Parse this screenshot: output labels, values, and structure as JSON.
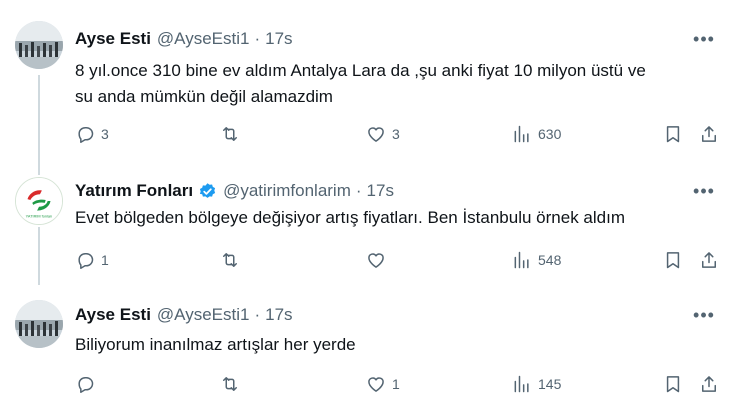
{
  "tweets": [
    {
      "name": "Ayse Esti",
      "handle": "@AyseEsti1",
      "dot": "·",
      "time": "17s",
      "text_lines": [
        "8 yıl.once 310 bine ev aldım  Antalya Lara da ,şu anki fiyat 10 milyon üstü ve",
        "su anda mümkün değil alamazdim"
      ],
      "replies": "3",
      "retweets": "",
      "likes": "3",
      "views": "630"
    },
    {
      "name": "Yatırım Fonları",
      "handle": "@yatirimfonlarim",
      "dot": "·",
      "time": "17s",
      "verified": true,
      "text_lines": [
        "Evet bölgeden bölgeye değişiyor artış fiyatları. Ben İstanbulu örnek aldım"
      ],
      "replies": "1",
      "retweets": "",
      "likes": "",
      "views": "548",
      "avatar_caption": "YATIRIM fonları"
    },
    {
      "name": "Ayse Esti",
      "handle": "@AyseEsti1",
      "dot": "·",
      "time": "17s",
      "text_lines": [
        "Biliyorum  inanılmaz artışlar her yerde"
      ],
      "replies": "",
      "retweets": "",
      "likes": "1",
      "views": "145"
    }
  ],
  "icons": {
    "more": "more-horizontal-icon",
    "reply": "reply-icon",
    "retweet": "retweet-icon",
    "like": "heart-icon",
    "views": "views-icon",
    "bookmark": "bookmark-icon",
    "share": "share-icon",
    "verified": "verified-badge-icon"
  },
  "colors": {
    "text": "#0f1419",
    "secondary": "#536471",
    "verified": "#1d9bf0",
    "thread_line": "#cfd9de",
    "logo_red": "#d92b2b",
    "logo_green": "#1f9a46"
  }
}
